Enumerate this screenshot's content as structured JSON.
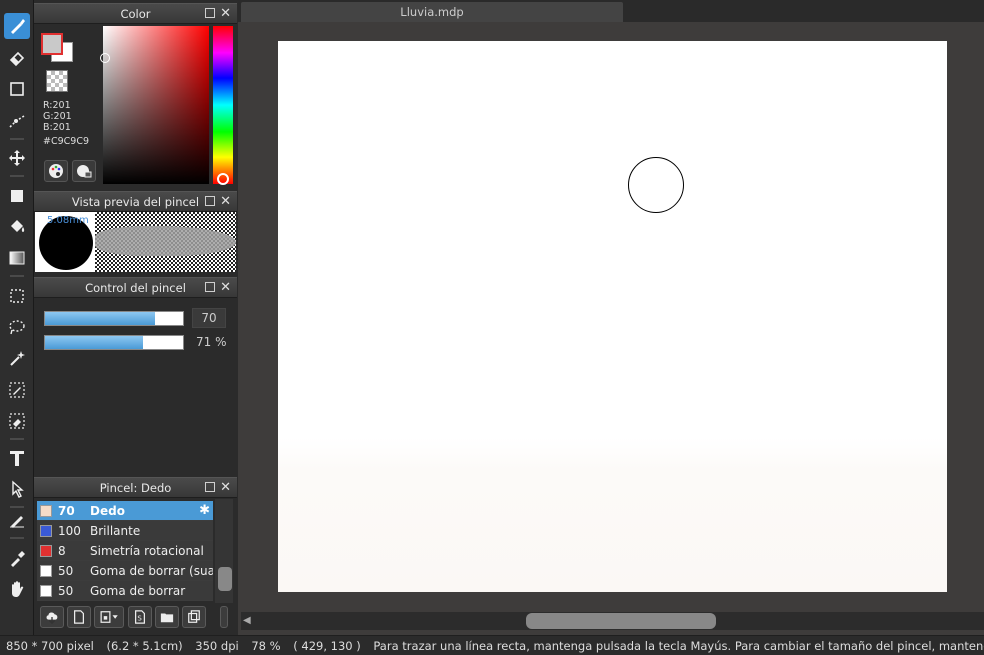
{
  "color_panel": {
    "title": "Color",
    "r": "R:201",
    "g": "G:201",
    "b": "B:201",
    "hex": "#C9C9C9",
    "foreground_color": "#c9c9c9",
    "background_color": "#ffffff"
  },
  "brush_preview_panel": {
    "title": "Vista previa del pincel",
    "size": "5.08mm"
  },
  "brush_control_panel": {
    "title": "Control del pincel",
    "size_value": "70",
    "size_fraction": 0.8,
    "opacity_value": "71 %",
    "opacity_fraction": 0.71
  },
  "brush_panel": {
    "title": "Pincel: Dedo",
    "items": [
      {
        "size": "70",
        "name": "Dedo",
        "color": "#f5dcc8",
        "selected": true
      },
      {
        "size": "100",
        "name": "Brillante",
        "color": "#3a5ad6",
        "selected": false
      },
      {
        "size": "8",
        "name": "Simetría rotacional",
        "color": "#e03030",
        "selected": false
      },
      {
        "size": "50",
        "name": "Goma de borrar (suave)",
        "color": "#ffffff",
        "selected": false
      },
      {
        "size": "50",
        "name": "Goma de borrar",
        "color": "#ffffff",
        "selected": false
      }
    ]
  },
  "document": {
    "tab_title": "Lluvia.mdp"
  },
  "status_bar": {
    "pixel_size": "850 * 700 pixel",
    "physical_size": "(6.2 * 5.1cm)",
    "dpi": "350 dpi",
    "zoom": "78 %",
    "coords": "( 429, 130 )",
    "hint": "Para trazar una línea recta, mantenga pulsada la tecla Mayús. Para cambiar el tamaño del pincel, mantenga pulsada las teclas Ctrl"
  },
  "icons": {
    "toolbar": [
      "brush-icon",
      "eraser-icon",
      "rectangle-icon",
      "dot-line-icon",
      "move-icon",
      "fill-rect-icon",
      "bucket-icon",
      "gradient-icon",
      "select-rect-icon",
      "lasso-icon",
      "magic-wand-icon",
      "select-pen-icon",
      "select-eraser-icon",
      "text-icon",
      "operation-icon",
      "pen-icon",
      "eyedropper-icon",
      "hand-icon"
    ]
  }
}
